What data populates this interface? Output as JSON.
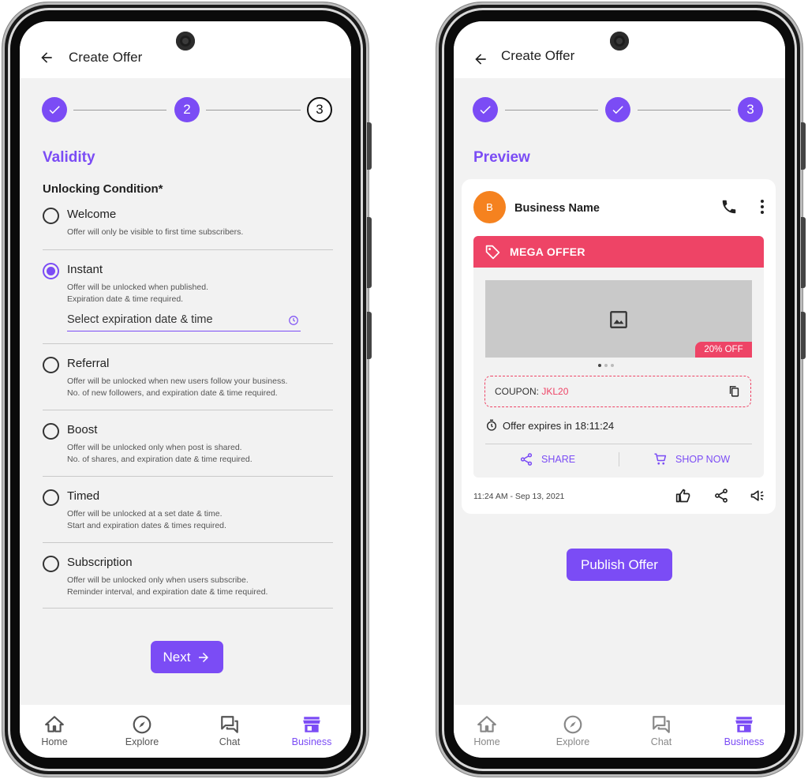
{
  "left_screen": {
    "header": {
      "title": "Create Offer"
    },
    "stepper": {
      "steps": [
        "",
        "2",
        "3"
      ]
    },
    "section_title": "Validity",
    "condition_title": "Unlocking Condition*",
    "options": [
      {
        "label": "Welcome",
        "desc": [
          "Offer will only be visible to first time subscribers."
        ],
        "selected": false
      },
      {
        "label": "Instant",
        "desc": [
          "Offer will be unlocked when published.",
          "Expiration date & time required."
        ],
        "selected": true
      },
      {
        "label": "Referral",
        "desc": [
          "Offer will be unlocked when new users follow your business.",
          "No. of new followers, and expiration date & time required."
        ],
        "selected": false
      },
      {
        "label": "Boost",
        "desc": [
          "Offer will be unlocked only when post is shared.",
          "No. of shares, and expiration date & time required."
        ],
        "selected": false
      },
      {
        "label": "Timed",
        "desc": [
          "Offer will be unlocked at a set date & time.",
          "Start and expiration dates & times required."
        ],
        "selected": false
      },
      {
        "label": "Subscription",
        "desc": [
          "Offer will be unlocked only when users subscribe.",
          "Reminder interval, and expiration date & time required."
        ],
        "selected": false
      }
    ],
    "expiration_placeholder": "Select expiration date & time",
    "next_label": "Next"
  },
  "right_screen": {
    "header": {
      "title": "Create Offer"
    },
    "stepper": {
      "steps": [
        "",
        "",
        "3"
      ]
    },
    "section_title": "Preview",
    "card": {
      "avatar_letter": "B",
      "business_name": "Business Name",
      "offer_title": "MEGA OFFER",
      "discount_badge": "20% OFF",
      "coupon_label": "COUPON:",
      "coupon_code": "JKL20",
      "expires_text": "Offer expires in 18:11:24",
      "share_label": "SHARE",
      "shop_label": "SHOP NOW",
      "timestamp": "11:24 AM - Sep 13, 2021"
    },
    "publish_label": "Publish Offer"
  },
  "nav": {
    "home": "Home",
    "explore": "Explore",
    "chat": "Chat",
    "business": "Business"
  },
  "colors": {
    "accent": "#7b4cf5",
    "offer_red": "#ee4466",
    "avatar_orange": "#f5821f"
  }
}
